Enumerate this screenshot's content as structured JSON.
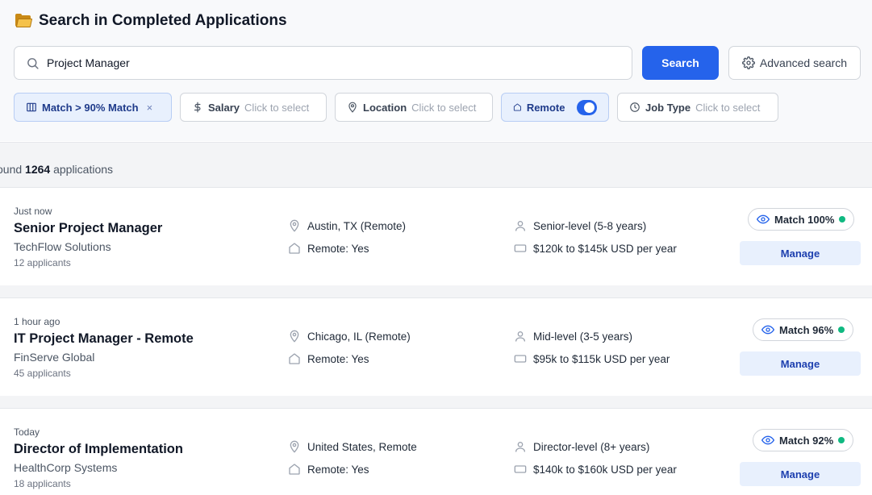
{
  "header": {
    "title": "Search in Completed Applications"
  },
  "search": {
    "value": "Project Manager",
    "button_label": "Search",
    "advanced_label": "Advanced search"
  },
  "filters": {
    "match": {
      "label": "Match > 90% Match",
      "clear": "×"
    },
    "salary": {
      "label": "Salary",
      "placeholder": "Click to select"
    },
    "location": {
      "label": "Location",
      "placeholder": "Click to select"
    },
    "remote": {
      "label": "Remote",
      "enabled": true
    },
    "job_type": {
      "label": "Job Type",
      "placeholder": "Click to select"
    }
  },
  "results": {
    "prefix": "ound ",
    "count": "1264",
    "suffix": " applications"
  },
  "jobs": [
    {
      "time": "Just now",
      "title": "Senior Project Manager",
      "company": "TechFlow Solutions",
      "applicants": "12 applicants",
      "location": "Austin, TX (Remote)",
      "remote": "Remote: Yes",
      "level": "Senior-level (5-8 years)",
      "salary": "$120k to $145k USD per year",
      "match": "Match 100%",
      "action": "Manage"
    },
    {
      "time": "1 hour ago",
      "title": "IT Project Manager - Remote",
      "company": "FinServe Global",
      "applicants": "45 applicants",
      "location": "Chicago, IL (Remote)",
      "remote": "Remote: Yes",
      "level": "Mid-level (3-5 years)",
      "salary": "$95k to $115k USD per year",
      "match": "Match 96%",
      "action": "Manage"
    },
    {
      "time": "Today",
      "title": "Director of Implementation",
      "company": "HealthCorp Systems",
      "applicants": "18 applicants",
      "location": "United States, Remote",
      "remote": "Remote: Yes",
      "level": "Director-level (8+ years)",
      "salary": "$140k to $160k USD per year",
      "match": "Match 92%",
      "action": "Manage"
    }
  ],
  "colors": {
    "primary": "#2563eb",
    "chip_active_bg": "#e8f0fd",
    "match_dot": "#10b981"
  }
}
